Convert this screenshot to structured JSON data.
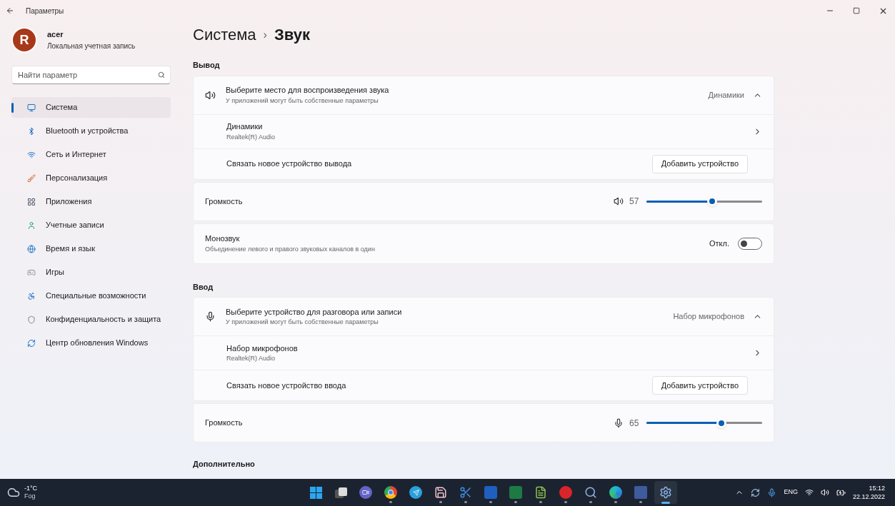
{
  "window": {
    "title": "Параметры"
  },
  "account": {
    "avatar_letter": "R",
    "name": "acer",
    "type": "Локальная учетная запись"
  },
  "search": {
    "placeholder": "Найти параметр"
  },
  "nav": [
    {
      "kind": "system",
      "label": "Система",
      "selected": true
    },
    {
      "kind": "bluetooth",
      "label": "Bluetooth и устройства",
      "selected": false
    },
    {
      "kind": "network",
      "label": "Сеть и Интернет",
      "selected": false
    },
    {
      "kind": "personalization",
      "label": "Персонализация",
      "selected": false
    },
    {
      "kind": "apps",
      "label": "Приложения",
      "selected": false
    },
    {
      "kind": "accounts",
      "label": "Учетные записи",
      "selected": false
    },
    {
      "kind": "time",
      "label": "Время и язык",
      "selected": false
    },
    {
      "kind": "gaming",
      "label": "Игры",
      "selected": false
    },
    {
      "kind": "accessibility",
      "label": "Специальные возможности",
      "selected": false
    },
    {
      "kind": "privacy",
      "label": "Конфиденциальность и защита",
      "selected": false
    },
    {
      "kind": "update",
      "label": "Центр обновления Windows",
      "selected": false
    }
  ],
  "breadcrumb": {
    "parent": "Система",
    "separator": "›",
    "current": "Звук"
  },
  "sections": [
    {
      "title": "Вывод",
      "device_group": {
        "kind": "speaker",
        "title": "Выберите место для воспроизведения звука",
        "subtitle": "У приложений могут быть собственные параметры",
        "value": "Динамики",
        "expanded": true,
        "device": {
          "name": "Динамики",
          "driver": "Realtek(R) Audio"
        },
        "pair": {
          "label": "Связать новое устройство вывода",
          "button": "Добавить устройство"
        }
      },
      "volume": {
        "label": "Громкость",
        "reading": "57",
        "level": 0.57
      },
      "mono": {
        "title": "Монозвук",
        "subtitle": "Объединение левого и правого звуковых каналов в один",
        "state_label": "Откл.",
        "on": false
      }
    },
    {
      "title": "Ввод",
      "device_group": {
        "kind": "microphone",
        "title": "Выберите устройство для разговора или записи",
        "subtitle": "У приложений могут быть собственные параметры",
        "value": "Набор микрофонов",
        "expanded": true,
        "device": {
          "name": "Набор микрофонов",
          "driver": "Realtek(R) Audio"
        },
        "pair": {
          "label": "Связать новое устройство ввода",
          "button": "Добавить устройство"
        }
      },
      "volume": {
        "label": "Громкость",
        "reading": "65",
        "level": 0.65
      }
    }
  ],
  "footer_heading": "Дополнительно",
  "taskbar": {
    "weather": {
      "temp": "-1°C",
      "condition": "Fog"
    },
    "apps": [
      {
        "kind": "start",
        "running": false,
        "selected": false
      },
      {
        "kind": "taskview",
        "running": false,
        "selected": false
      },
      {
        "kind": "chat",
        "running": false,
        "selected": false
      },
      {
        "kind": "chrome",
        "running": true,
        "selected": false
      },
      {
        "kind": "telegram",
        "running": false,
        "selected": false
      },
      {
        "kind": "floppy",
        "running": true,
        "selected": false
      },
      {
        "kind": "snip",
        "running": true,
        "selected": false
      },
      {
        "kind": "word",
        "running": true,
        "selected": false
      },
      {
        "kind": "excel",
        "running": true,
        "selected": false
      },
      {
        "kind": "notepad",
        "running": true,
        "selected": false
      },
      {
        "kind": "red",
        "running": true,
        "selected": false
      },
      {
        "kind": "magnifier",
        "running": true,
        "selected": false
      },
      {
        "kind": "edge",
        "running": true,
        "selected": false
      },
      {
        "kind": "dev",
        "running": true,
        "selected": false
      },
      {
        "kind": "settings",
        "running": false,
        "selected": true
      }
    ],
    "tray": {
      "language": "ENG",
      "time": "15:12",
      "date": "22.12.2022"
    }
  }
}
